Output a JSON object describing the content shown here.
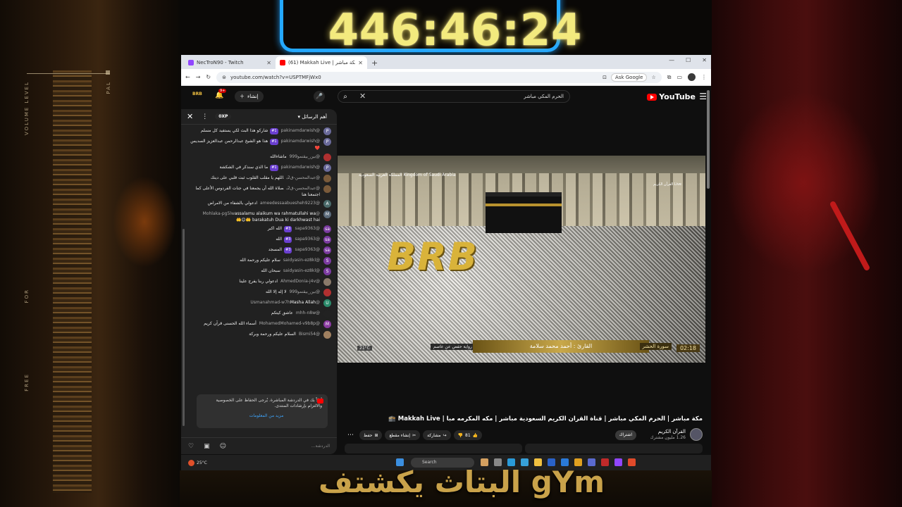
{
  "overlay": {
    "timer": "446:46:24",
    "caption": "البتاث يكشتف gYm",
    "side_text_left": "VOLUME LEVEL",
    "side_text_left2": "FOR",
    "side_text_left3": "FREE",
    "side_text_right": "PAL"
  },
  "browser": {
    "tabs": [
      {
        "title": "NecTroN90 - Twitch",
        "active": false
      },
      {
        "title": "(61) Makkah Live | مكة مباشر",
        "active": true
      }
    ],
    "new_tab": "+",
    "url": "youtube.com/watch?v=USPTMFjWx0",
    "ask_google": "Ask Google"
  },
  "youtube": {
    "logo": "YouTube",
    "search_value": "الحرم المكي مباشر",
    "create_label": "إنشاء",
    "notif_count": "9+",
    "channel_logo": "BRB"
  },
  "chat": {
    "header_select": "أهم الرسائل",
    "xp": "0XP",
    "messages": [
      {
        "author": "@pakinamdarwish",
        "badge": "#1",
        "text": "شاركو هذا البث لكي يستفيد كل مسلم",
        "color": "#6a6a9a",
        "initial": "P"
      },
      {
        "author": "@pakinamdarwish",
        "badge": "#1",
        "text": "هذا هو الشيخ عبدالرحمن عبدالعزيز السديس ❤️",
        "color": "#6a6a9a",
        "initial": "P"
      },
      {
        "author": "@بين_بيقنمو999",
        "badge": "",
        "text": "ماشاءالله",
        "color": "#b03030",
        "initial": ""
      },
      {
        "author": "@pakinamdarwish",
        "badge": "#1",
        "text": "ما الذي سنذكر في الشكشة",
        "color": "#6a6a9a",
        "initial": "P"
      },
      {
        "author": "@عبدالمحسن-ق2ب",
        "badge": "",
        "text": "اللهم يا مقلب القلوب ثبت قلبي على دينك",
        "color": "#7a5a3a",
        "initial": ""
      },
      {
        "author": "@عبدالمحسن-ق2ب",
        "badge": "",
        "text": "صلاة الله أن يجمعنا في جنات الفردوس الأعلى كما اجتمعنا هنا",
        "color": "#7a5a3a",
        "initial": ""
      },
      {
        "author": "@ameedessaabuesheh9223",
        "badge": "",
        "text": "ادعولي بالشفاء من الامراض",
        "color": "#4a6a6a",
        "initial": "A"
      },
      {
        "author": "@Mohlaka-pg5lw",
        "badge": "",
        "text": "assalamu alaikum wa rahmatullahi wa barakatuh Dua ki darkhwast hai 🤲😊🤲",
        "color": "#5a6a7a",
        "initial": "M"
      },
      {
        "author": "@sapa9363",
        "badge": "#3",
        "text": "الله اكبر",
        "color": "#7a3aa0",
        "initial": "sa"
      },
      {
        "author": "@sapa9363",
        "badge": "#3",
        "text": "الله",
        "color": "#7a3aa0",
        "initial": "sa"
      },
      {
        "author": "@sapa9363",
        "badge": "#3",
        "text": "المسجد",
        "color": "#7a3aa0",
        "initial": "sa"
      },
      {
        "author": "@saidyasin-ez8kl",
        "badge": "",
        "text": "سلام عليكم ورحمة الله",
        "color": "#7a3aa0",
        "initial": "S"
      },
      {
        "author": "@saidyasin-ez8kl",
        "badge": "",
        "text": "سبحان الله",
        "color": "#7a3aa0",
        "initial": "S"
      },
      {
        "author": "@AhmedDonia-j4v",
        "badge": "",
        "text": "ادعولي ربنا يفرج علينا",
        "color": "#8a7a6a",
        "initial": ""
      },
      {
        "author": "@بين_بيقنمو999",
        "badge": "",
        "text": "لا إله إلا الله",
        "color": "#b03030",
        "initial": ""
      },
      {
        "author": "@Usmanahmad-w7h",
        "badge": "",
        "text": "Masha Allah",
        "color": "#2a8a6a",
        "initial": "U"
      },
      {
        "author": "@mhh-n8w",
        "badge": "",
        "text": "عاشق كيتكم",
        "color": "#222222",
        "initial": ""
      },
      {
        "author": "@MohamedMohamed-v9b8p",
        "badge": "",
        "text": "أسماء الله الحسنى قرآن كريم",
        "color": "#8a3aa0",
        "initial": "M"
      },
      {
        "author": "@Bismi54",
        "badge": "",
        "text": "السلام عليكم ورحمة وبركة",
        "color": "#a08060",
        "initial": ""
      }
    ],
    "notice": "أهلاً بك في الدردشة المباشرة. يُرجى الحفاظ على الخصوصية والالتزام بإرشادات المنتدى.",
    "notice_link": "مزيد من المعلومات",
    "input_placeholder": "الدردشة..."
  },
  "video": {
    "overlay_text": "BRB",
    "logo_text": "المملكة العربية السعودية Kingdom of Saudi Arabia",
    "live_text": "القرآن الكريم Live",
    "reciter": "القارئ : أحمد محمد سلامة",
    "surah": "سورة الحشر",
    "narration": "رواية حفص عن عاصم",
    "time": "02:18",
    "temp": "21°C"
  },
  "details": {
    "title": "مكة مباشر | الحرم المكي مباشر | قناة القران الكريم السعودية مباشر | مكه المكرمه مبا | Makkah Live 🕋",
    "channel": "القرآن الكريم",
    "subscribers": "1.26 مليون مشترك",
    "join": "اشتراك",
    "likes": "81",
    "share": "مشاركة",
    "clip": "إنشاء مقطع",
    "save": "حفظ"
  },
  "taskbar": {
    "temp": "25°C",
    "search": "Search"
  }
}
